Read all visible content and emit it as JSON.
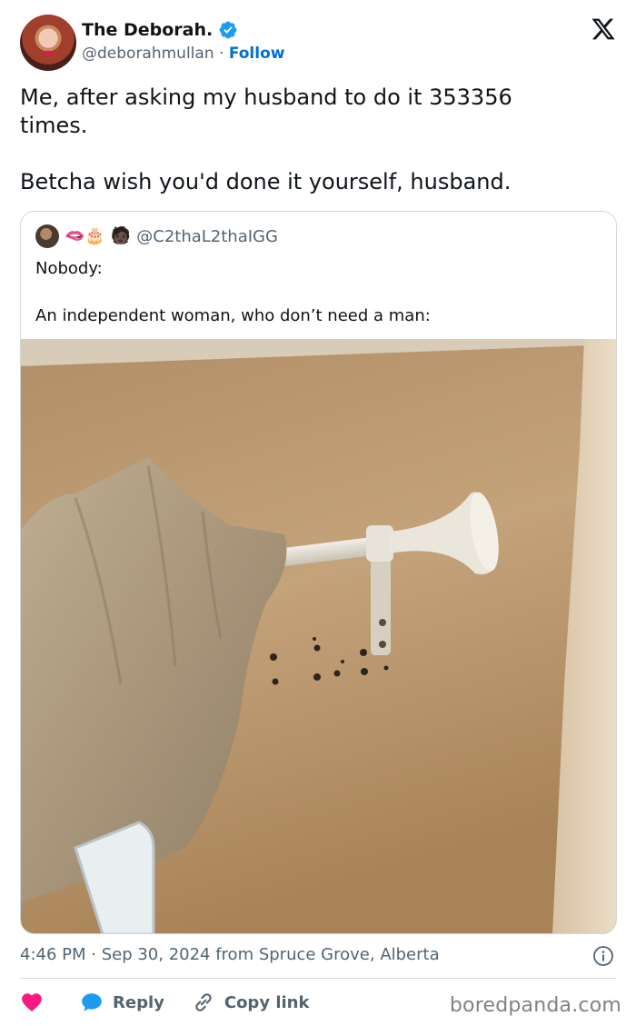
{
  "author": {
    "display_name": "The Deborah.",
    "handle": "@deborahmullan",
    "separator": "·",
    "follow_label": "Follow",
    "verified": true
  },
  "icons": {
    "verified": "verified-badge-icon",
    "platform": "x-logo-icon",
    "info": "info-icon",
    "like": "heart-icon",
    "reply": "reply-bubble-icon",
    "copy": "link-icon"
  },
  "colors": {
    "accent": "#006fd6",
    "verified": "#1d9bf0",
    "like": "#f91880",
    "muted": "#536471",
    "border": "#cfd9de"
  },
  "tweet": {
    "text": "Me, after asking my husband to do it 353356\ntimes.\n\nBetcha wish you'd done it yourself, husband."
  },
  "quote": {
    "emojis": "🫦🎂",
    "emoji_trailing": "🧑🏿",
    "handle": "@C2thaL2thaIGG",
    "text": "Nobody:\n\nAn independent woman, who don’t need a man:"
  },
  "meta": {
    "timestamp": "4:46 PM · Sep 30, 2024 from Spruce Grove, Alberta"
  },
  "actions": {
    "reply_label": "Reply",
    "copy_label": "Copy link"
  },
  "watermark": "boredpanda.com"
}
